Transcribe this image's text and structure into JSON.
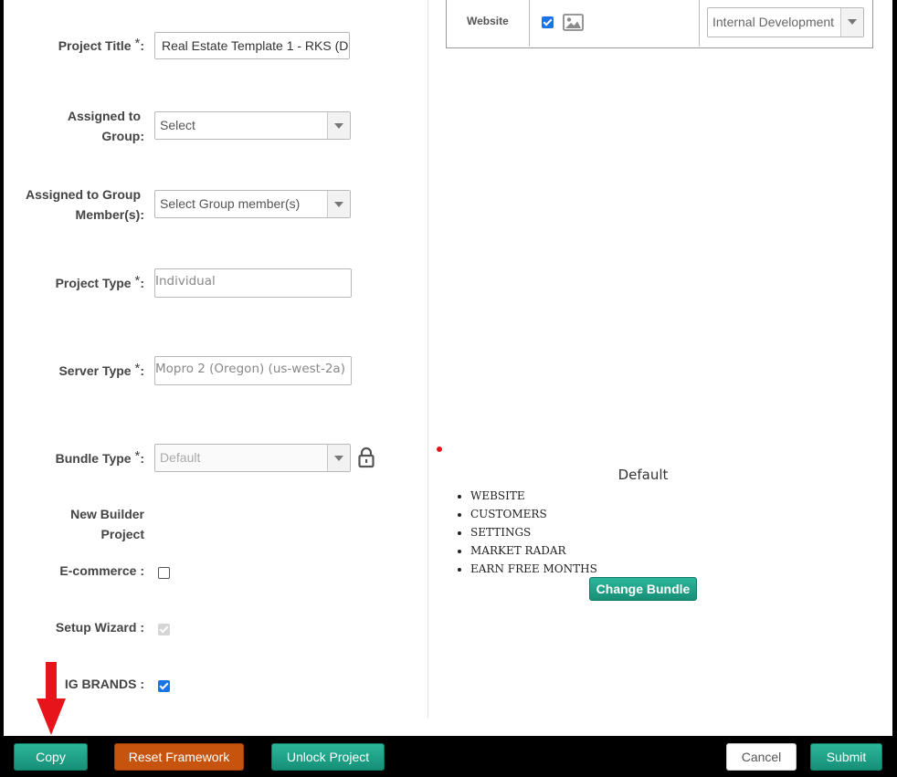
{
  "form": {
    "project_title": {
      "label": "Project Title",
      "value": "Real Estate Template 1 - RKS (D"
    },
    "assigned_group": {
      "label_line1": "Assigned to",
      "label_line2": "Group:",
      "value": "Select"
    },
    "assigned_members": {
      "label_line1": "Assigned to Group",
      "label_line2": "Member(s):",
      "value": "Select Group member(s)"
    },
    "project_type": {
      "label": "Project Type",
      "value": "Individual"
    },
    "server_type": {
      "label": "Server Type",
      "value": "Mopro 2 (Oregon) (us-west-2a)"
    },
    "bundle_type": {
      "label": "Bundle Type",
      "value": "Default"
    },
    "new_builder": {
      "label_line1": "New Builder",
      "label_line2": "Project"
    },
    "ecommerce": {
      "label": "E-commerce :",
      "checked": false
    },
    "setup_wizard": {
      "label": "Setup Wizard :",
      "checked": true
    },
    "ig_brands": {
      "label": "IG BRANDS :",
      "checked": true
    },
    "required_mark": "*",
    "colon": ":"
  },
  "site_table": {
    "label": "Website",
    "checked": true,
    "select_value": "Internal Development"
  },
  "bundle": {
    "name": "Default",
    "features": [
      "WEBSITE",
      "CUSTOMERS",
      "SETTINGS",
      "MARKET RADAR",
      "EARN FREE MONTHS"
    ],
    "change_button": "Change Bundle"
  },
  "footer": {
    "copy": "Copy",
    "reset": "Reset Framework",
    "unlock": "Unlock Project",
    "cancel": "Cancel",
    "submit": "Submit"
  },
  "colors": {
    "green": "#1fa386",
    "orange": "#c7540e",
    "arrow": "#e8141b",
    "check_blue": "#1a73e8"
  }
}
